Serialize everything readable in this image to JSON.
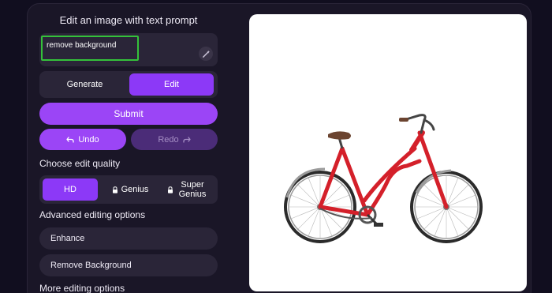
{
  "panel": {
    "title": "Edit an image with text prompt",
    "prompt": {
      "value": "remove background",
      "placeholder": ""
    },
    "mode_tabs": [
      {
        "label": "Generate",
        "active": false
      },
      {
        "label": "Edit",
        "active": true
      }
    ],
    "submit_label": "Submit",
    "undo_label": "Undo",
    "redo_label": "Redo",
    "quality_heading": "Choose edit quality",
    "quality_options": [
      {
        "label": "HD",
        "selected": true,
        "locked": false
      },
      {
        "label": "Genius",
        "selected": false,
        "locked": true
      },
      {
        "label": "Super Genius",
        "selected": false,
        "locked": true
      }
    ],
    "advanced_heading": "Advanced editing options",
    "advanced_options": [
      {
        "label": "Enhance"
      },
      {
        "label": "Remove Background"
      }
    ],
    "more_heading": "More editing options"
  },
  "preview": {
    "subject": "red-bicycle"
  },
  "colors": {
    "accent": "#9b45f6",
    "accent_active": "#8c39f7",
    "redo_disabled": "#4b2c78",
    "panel_bg": "#2a2538",
    "page_bg": "#110e1f",
    "focus_outline": "#34c23a"
  }
}
